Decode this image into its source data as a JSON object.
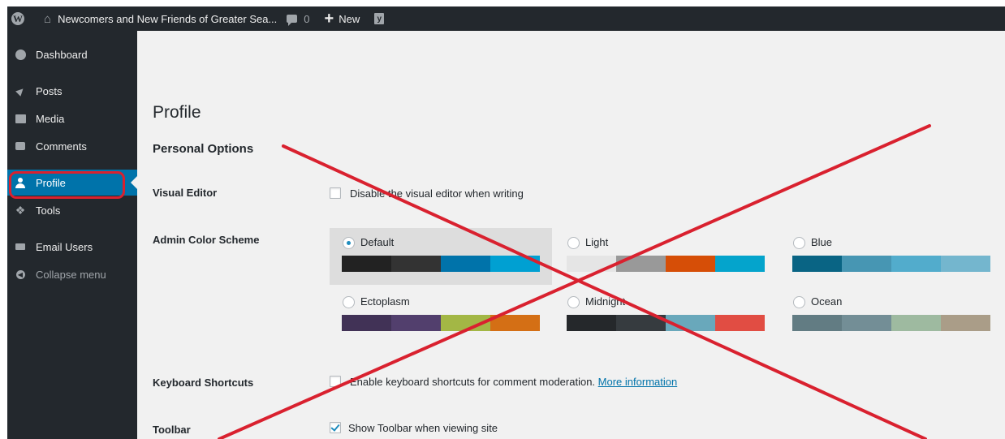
{
  "adminbar": {
    "site_name": "Newcomers and New Friends of Greater Sea...",
    "comment_count": "0",
    "new_label": "New"
  },
  "sidebar": {
    "items": [
      {
        "label": "Dashboard",
        "icon": "dashboard-icon"
      },
      {
        "label": "Posts",
        "icon": "pushpin-icon"
      },
      {
        "label": "Media",
        "icon": "media-icon"
      },
      {
        "label": "Comments",
        "icon": "comment-icon"
      },
      {
        "label": "Profile",
        "icon": "user-icon",
        "current": true
      },
      {
        "label": "Tools",
        "icon": "wrench-icon"
      },
      {
        "label": "Email Users",
        "icon": "mail-icon"
      },
      {
        "label": "Collapse menu",
        "icon": "collapse-icon"
      }
    ]
  },
  "page": {
    "title": "Profile",
    "section_title": "Personal Options",
    "visual_editor": {
      "label": "Visual Editor",
      "checkbox_text": "Disable the visual editor when writing",
      "checked": false
    },
    "admin_color_scheme": {
      "label": "Admin Color Scheme",
      "schemes": [
        {
          "name": "Default",
          "selected": true,
          "colors": [
            "#222222",
            "#333333",
            "#0073aa",
            "#00a0d2"
          ]
        },
        {
          "name": "Light",
          "selected": false,
          "colors": [
            "#e5e5e5",
            "#999999",
            "#d64e07",
            "#04a4cc"
          ]
        },
        {
          "name": "Blue",
          "selected": false,
          "colors": [
            "#096484",
            "#4796b3",
            "#52accc",
            "#74b6ce"
          ]
        },
        {
          "name": "Ectoplasm",
          "selected": false,
          "colors": [
            "#413256",
            "#523f6d",
            "#a3b745",
            "#d46f15"
          ]
        },
        {
          "name": "Midnight",
          "selected": false,
          "colors": [
            "#25282b",
            "#363b3f",
            "#69a8bb",
            "#e14d43"
          ]
        },
        {
          "name": "Ocean",
          "selected": false,
          "colors": [
            "#627c83",
            "#738e96",
            "#9ebaa0",
            "#aa9d88"
          ]
        }
      ]
    },
    "keyboard_shortcuts": {
      "label": "Keyboard Shortcuts",
      "checkbox_text": "Enable keyboard shortcuts for comment moderation.",
      "link_text": "More information",
      "checked": false
    },
    "toolbar": {
      "label": "Toolbar",
      "checkbox_text": "Show Toolbar when viewing site",
      "checked": true
    }
  },
  "annotation": {
    "highlight_color": "#d9212f",
    "cross_color": "#d9212f"
  }
}
